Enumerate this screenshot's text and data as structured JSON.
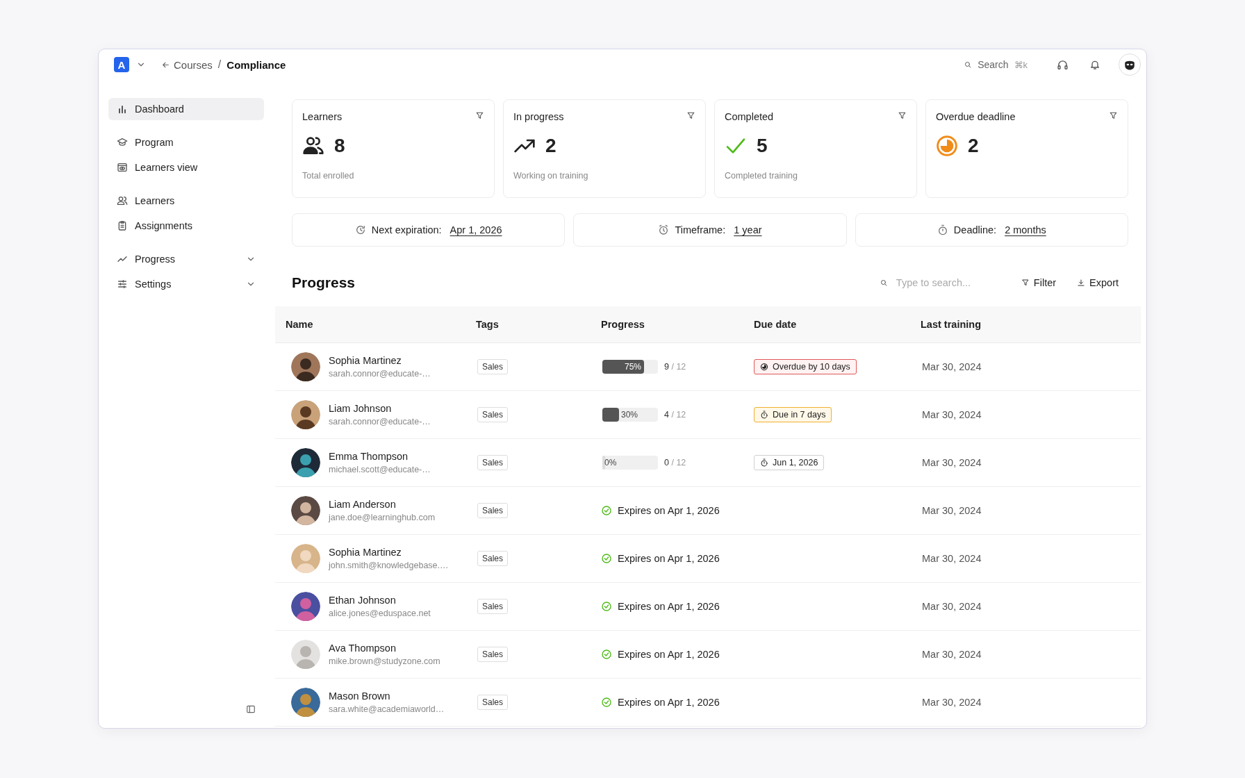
{
  "app": {
    "logo": "A"
  },
  "breadcrumb": {
    "back": "Courses",
    "separator": "/",
    "current": "Compliance"
  },
  "search": {
    "label": "Search",
    "shortcut": "⌘k"
  },
  "sidebar": {
    "sections": [
      {
        "items": [
          {
            "label": "Dashboard",
            "kind": "link",
            "selected": true
          }
        ]
      },
      {
        "items": [
          {
            "label": "Program",
            "kind": "link",
            "selected": false
          },
          {
            "label": "Learners view",
            "kind": "link",
            "selected": false
          }
        ]
      },
      {
        "items": [
          {
            "label": "Learners",
            "kind": "link",
            "selected": false
          },
          {
            "label": "Assignments",
            "kind": "link",
            "selected": false
          }
        ]
      },
      {
        "items": [
          {
            "label": "Progress",
            "kind": "menu",
            "selected": false
          },
          {
            "label": "Settings",
            "kind": "menu",
            "selected": false
          }
        ]
      }
    ]
  },
  "stats": [
    {
      "label": "Learners",
      "value": "8",
      "caption": "Total enrolled"
    },
    {
      "label": "In progress",
      "value": "2",
      "caption": "Working on training"
    },
    {
      "label": "Completed",
      "value": "5",
      "caption": "Completed training"
    },
    {
      "label": "Overdue deadline",
      "value": "2"
    }
  ],
  "info": [
    {
      "label": "Next expiration:",
      "value": "Apr 1, 2026"
    },
    {
      "label": "Timeframe:",
      "value": "1 year"
    },
    {
      "label": "Deadline:",
      "value": "2 months"
    }
  ],
  "progress": {
    "title": "Progress",
    "search_placeholder": "Type to search...",
    "actions": [
      "Filter",
      "Export"
    ],
    "table": {
      "columns": [
        "Name",
        "Tags",
        "Progress",
        "Due date",
        "Last training"
      ],
      "rows": [
        {
          "name": "Sophia Martinez",
          "email": "sarah.connor@educate-…",
          "tag": "Sales",
          "progress": {
            "kind": "bar",
            "level": 0.75,
            "label": "75%",
            "done": "9",
            "total": "/ 12"
          },
          "due": {
            "kind": "overdue",
            "text": "Overdue by 10 days"
          },
          "last": "Mar 30, 2024"
        },
        {
          "name": "Liam Johnson",
          "email": "sarah.connor@educate-…",
          "tag": "Sales",
          "progress": {
            "kind": "bar",
            "level": 0.3,
            "label": "30%",
            "done": "4",
            "total": "/ 12"
          },
          "due": {
            "kind": "soon",
            "text": "Due in 7 days"
          },
          "last": "Mar 30, 2024"
        },
        {
          "name": "Emma Thompson",
          "email": "michael.scott@educate-…",
          "tag": "Sales",
          "progress": {
            "kind": "bar",
            "level": 0,
            "label": "0%",
            "done": "0",
            "total": "/ 12"
          },
          "due": {
            "kind": "date",
            "text": "Jun 1, 2026"
          },
          "last": "Mar 30, 2024"
        },
        {
          "name": "Liam Anderson",
          "email": "jane.doe@learninghub.com",
          "tag": "Sales",
          "progress": {
            "kind": "expires",
            "text": "Expires on Apr 1, 2026"
          },
          "last": "Mar 30, 2024"
        },
        {
          "name": "Sophia Martinez",
          "email": "john.smith@knowledgebase.…",
          "tag": "Sales",
          "progress": {
            "kind": "expires",
            "text": "Expires on Apr 1, 2026"
          },
          "last": "Mar 30, 2024"
        },
        {
          "name": "Ethan Johnson",
          "email": "alice.jones@eduspace.net",
          "tag": "Sales",
          "progress": {
            "kind": "expires",
            "text": "Expires on Apr 1, 2026"
          },
          "last": "Mar 30, 2024"
        },
        {
          "name": "Ava Thompson",
          "email": "mike.brown@studyzone.com",
          "tag": "Sales",
          "progress": {
            "kind": "expires",
            "text": "Expires on Apr 1, 2026"
          },
          "last": "Mar 30, 2024"
        },
        {
          "name": "Mason Brown",
          "email": "sara.white@academiaworld…",
          "tag": "Sales",
          "progress": {
            "kind": "expires",
            "text": "Expires on Apr 1, 2026"
          },
          "last": "Mar 30, 2024"
        }
      ]
    }
  }
}
